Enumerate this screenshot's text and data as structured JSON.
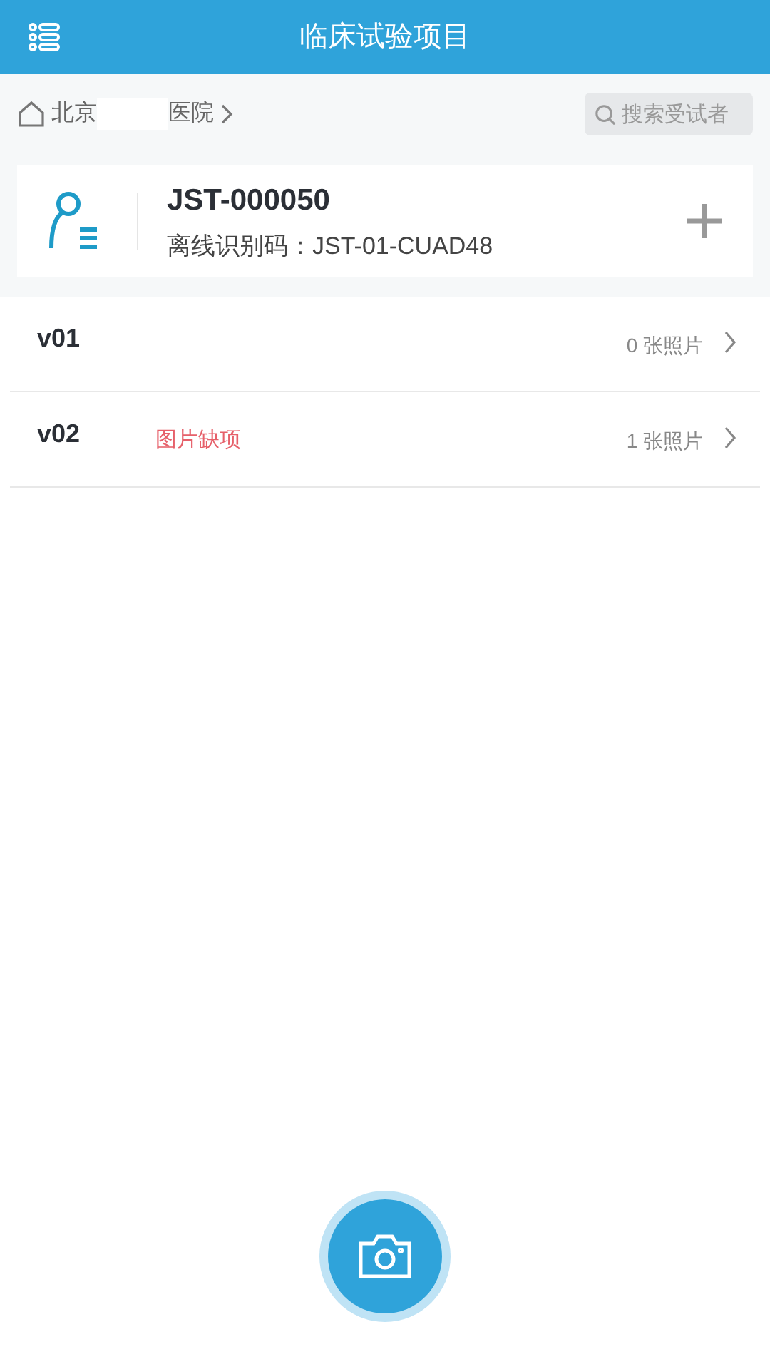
{
  "header": {
    "title": "临床试验项目"
  },
  "breadcrumb": {
    "parts": [
      "北京",
      "医院"
    ]
  },
  "search": {
    "placeholder": "搜索受试者"
  },
  "subject": {
    "id": "JST-000050",
    "offline_code": "离线识别码：JST-01-CUAD48"
  },
  "visits": [
    {
      "name": "v01",
      "photos": "0 张照片"
    },
    {
      "name": "v02",
      "warning": "图片缺项",
      "photos": "1 张照片"
    }
  ]
}
